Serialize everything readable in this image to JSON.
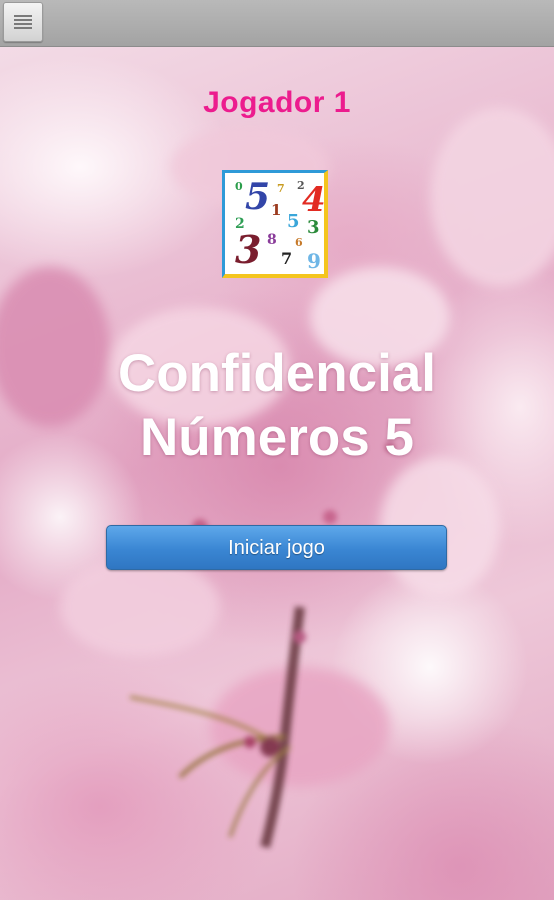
{
  "topbar": {
    "menu_icon": "hamburger-menu-icon"
  },
  "main": {
    "player_label": "Jogador 1",
    "title_line1": "Confidencial",
    "title_line2": "Números 5",
    "start_button_label": "Iniciar jogo"
  },
  "logo": {
    "digits": [
      "0",
      "5",
      "1",
      "7",
      "2",
      "4",
      "2",
      "5",
      "3",
      "3",
      "8",
      "6",
      "7",
      "9"
    ]
  },
  "colors": {
    "player_label": "#ec1c8e",
    "button": "#3a86d3",
    "topbar": "#aeaeae",
    "logo_border_blue": "#2e9ad8",
    "logo_border_yellow": "#f4c51e"
  }
}
